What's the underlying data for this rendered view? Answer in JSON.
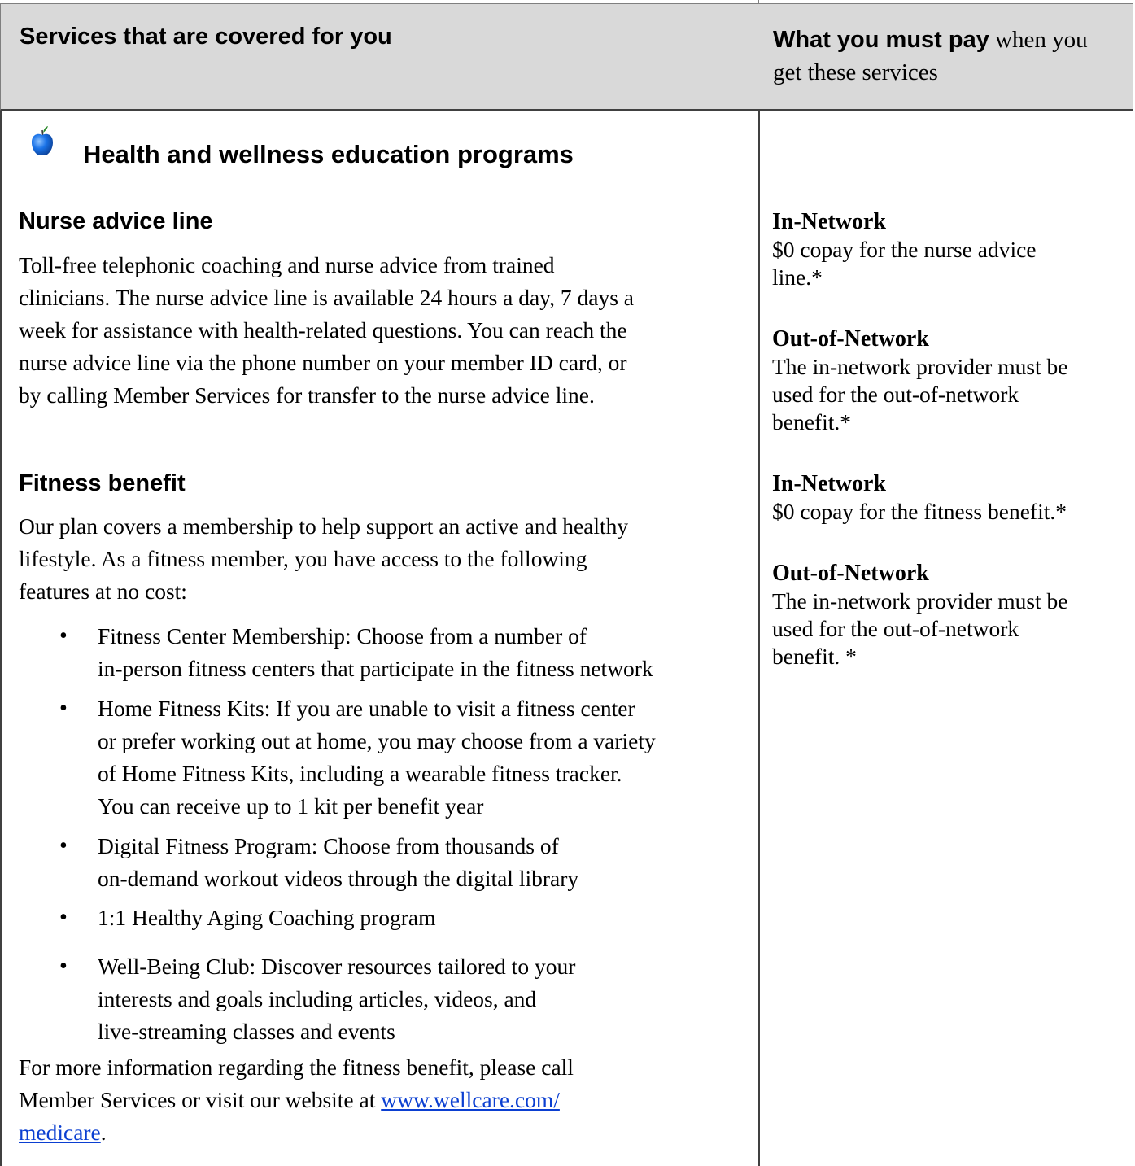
{
  "header": {
    "col_left": "Services that are covered for you",
    "col_right_bold": "What you must pay",
    "col_right_rest": " when you get these services"
  },
  "section": {
    "icon": "apple-icon",
    "title": "Health and wellness education programs"
  },
  "nurse": {
    "title": "Nurse advice line",
    "lines": [
      "Toll-free telephonic coaching and nurse advice from trained",
      "clinicians. The nurse advice line is available 24 hours a day, 7 days a",
      "week for assistance with health-related questions. You can reach the",
      "nurse advice line via the phone number on your member ID card, or",
      "by calling Member Services for transfer to the nurse advice line."
    ],
    "in_network_label": "In-Network",
    "in_network_lines": [
      "$0 copay for the nurse advice",
      "line.*"
    ],
    "out_network_label": "Out-of-Network",
    "out_network_lines": [
      "The in-network provider must be",
      "used for the out-of-network",
      "benefit.*"
    ]
  },
  "fitness": {
    "title": "Fitness benefit",
    "intro_lines": [
      "Our plan covers a membership to help support an active and healthy",
      "lifestyle. As a fitness member, you have access to the following",
      "features at no cost:"
    ],
    "bullets": [
      [
        "Fitness Center Membership: Choose from a number of",
        "in-person fitness centers that participate in the fitness network"
      ],
      [
        "Home Fitness Kits: If you are unable to visit a fitness center",
        "or prefer working out at home, you may choose from a variety",
        "of Home Fitness Kits, including a wearable fitness tracker.",
        "You can receive up to 1 kit per benefit year"
      ],
      [
        "Digital Fitness Program: Choose from thousands of",
        "on-demand workout videos through the digital library"
      ],
      [
        "1:1 Healthy Aging Coaching program"
      ],
      [
        "Well-Being Club: Discover resources tailored to your",
        "interests and goals including articles, videos, and",
        "live-streaming classes and events"
      ]
    ],
    "bullet_char": "•",
    "footer_line1": "For more information regarding the fitness benefit, please call",
    "footer_line2_prefix": "Member Services or visit our website at ",
    "link_part1": "www.wellcare.com/",
    "link_part2": "medicare",
    "footer_suffix": ".",
    "in_network_label": "In-Network",
    "in_network_lines": [
      "$0 copay for the fitness benefit.*"
    ],
    "out_network_label": "Out-of-Network",
    "out_network_lines": [
      "The in-network provider must be",
      "used for the out-of-network",
      "benefit. *"
    ]
  },
  "colors": {
    "header_bg": "#d9d9d9",
    "link": "#0b3fd1",
    "apple": "#1a73e8"
  }
}
